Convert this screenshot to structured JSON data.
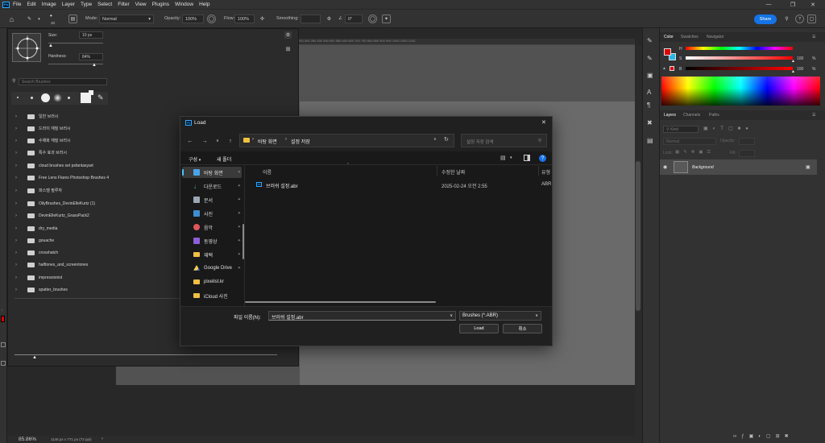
{
  "app": {
    "logo": "Ps"
  },
  "menu": [
    "File",
    "Edit",
    "Image",
    "Layer",
    "Type",
    "Select",
    "Filter",
    "View",
    "Plugins",
    "Window",
    "Help"
  ],
  "options_bar": {
    "brush_size_small": "10",
    "mode_label": "Mode:",
    "mode_value": "Normal",
    "opacity_label": "Opacity:",
    "opacity_value": "100%",
    "flow_label": "Flow:",
    "flow_value": "100%",
    "smoothing_label": "Smoothing:",
    "smoothing_value": "",
    "angle_value": "0°",
    "share_label": "Share"
  },
  "brush_panel": {
    "size_label": "Size:",
    "size_value": "10 px",
    "hardness_label": "Hardness:",
    "hardness_value": "84%",
    "search_placeholder": "Search Brushes",
    "folders": [
      "일반 브러시",
      "드라이 재질 브러시",
      "수채화 재질 브러시",
      "특수 효과 브러시",
      "cloud brushes set psfantasyart",
      "Free Lens Flares Photoshop Brushes 4",
      "파스텔 필루자",
      "OilyBrushes_DevinElleKurtz (1)",
      "DevinElleKurtz_GrassPack2",
      "dry_media",
      "gouache",
      "crosshatch",
      "halftones_and_screentones",
      "impressionist",
      "spatter_brushes"
    ]
  },
  "status": {
    "zoom": "85.86%",
    "doc_info": "1146 px x 771 px (72 ppi)"
  },
  "ruler_ticks": "250   300   350   400   450   500   550   600   650   700   750   800   850   900   950   1000  1050  1100",
  "color_panel": {
    "tabs": [
      "Color",
      "Swatches",
      "Navigator"
    ],
    "h_label": "H",
    "h_value": "",
    "s_label": "S",
    "s_value": "100",
    "b_label": "B",
    "b_value": "100",
    "pct": "%"
  },
  "layers_panel": {
    "tabs": [
      "Layers",
      "Channels",
      "Paths"
    ],
    "kind_placeholder": "Kind",
    "blend_mode": "Normal",
    "opacity_label": "Opacity:",
    "lock_label": "Lock:",
    "fill_label": "Fill:",
    "layer_name": "Background"
  },
  "dialog": {
    "title_icon": "Ps",
    "title": "Load",
    "breadcrumb": [
      "바탕 화면",
      "설정 저장"
    ],
    "search_placeholder": "설정 저장 검색",
    "organize_label": "구성",
    "new_folder_label": "새 폴더",
    "side_items": [
      "바탕 화면",
      "다운로드",
      "문서",
      "사진",
      "음악",
      "동영상",
      "재택",
      "Google Drive",
      "pixelist.kr",
      "iCloud 사진"
    ],
    "columns": {
      "name": "이름",
      "modified": "수정한 날짜",
      "type": "유형"
    },
    "files": [
      {
        "name": "브러쉬 설정.abr",
        "modified": "2025-02-24 오전 2:55",
        "type": "ABR"
      }
    ],
    "filename_label": "파일 이름(N):",
    "filename_value": "브러쉬 설정.abr",
    "filter_value": "Brushes (*.ABR)",
    "load_label": "Load",
    "cancel_label": "취소"
  }
}
